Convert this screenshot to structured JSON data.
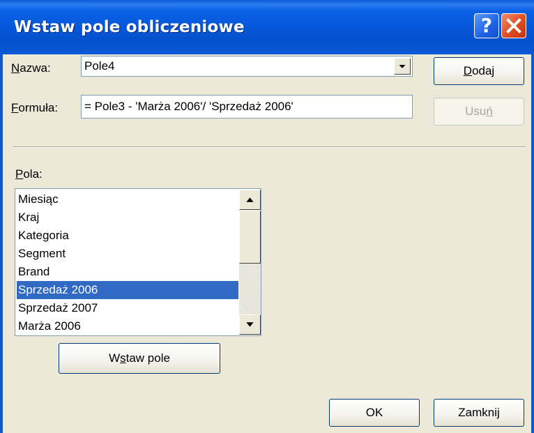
{
  "window": {
    "title": "Wstaw pole obliczeniowe",
    "help_glyph": "?",
    "accent_color": "#0a5ad0",
    "close_color": "#e04c22"
  },
  "name_field": {
    "label_accel": "N",
    "label_rest": "azwa:",
    "value": "Pole4"
  },
  "formula_field": {
    "label_accel": "F",
    "label_rest": "ormuła:",
    "value": "= Pole3 - 'Marża 2006'/ 'Sprzedaż 2006'"
  },
  "buttons": {
    "add_accel": "D",
    "add_rest": "odaj",
    "delete_pre": "Usu",
    "delete_accel": "ń",
    "insert_pre": "W",
    "insert_accel": "s",
    "insert_rest": "taw pole",
    "ok": "OK",
    "close": "Zamknij"
  },
  "fields_list": {
    "label_accel": "P",
    "label_rest": "ola:",
    "items": [
      "Miesiąc",
      "Kraj",
      "Kategoria",
      "Segment",
      "Brand",
      "Sprzedaż 2006",
      "Sprzedaż 2007",
      "Marża 2006"
    ],
    "selected": "Sprzedaż 2006"
  },
  "icons": {
    "help": "help-icon",
    "close": "close-icon",
    "dropdown": "dropdown-arrow-icon",
    "scroll_up": "scroll-up-icon",
    "scroll_down": "scroll-down-icon"
  }
}
